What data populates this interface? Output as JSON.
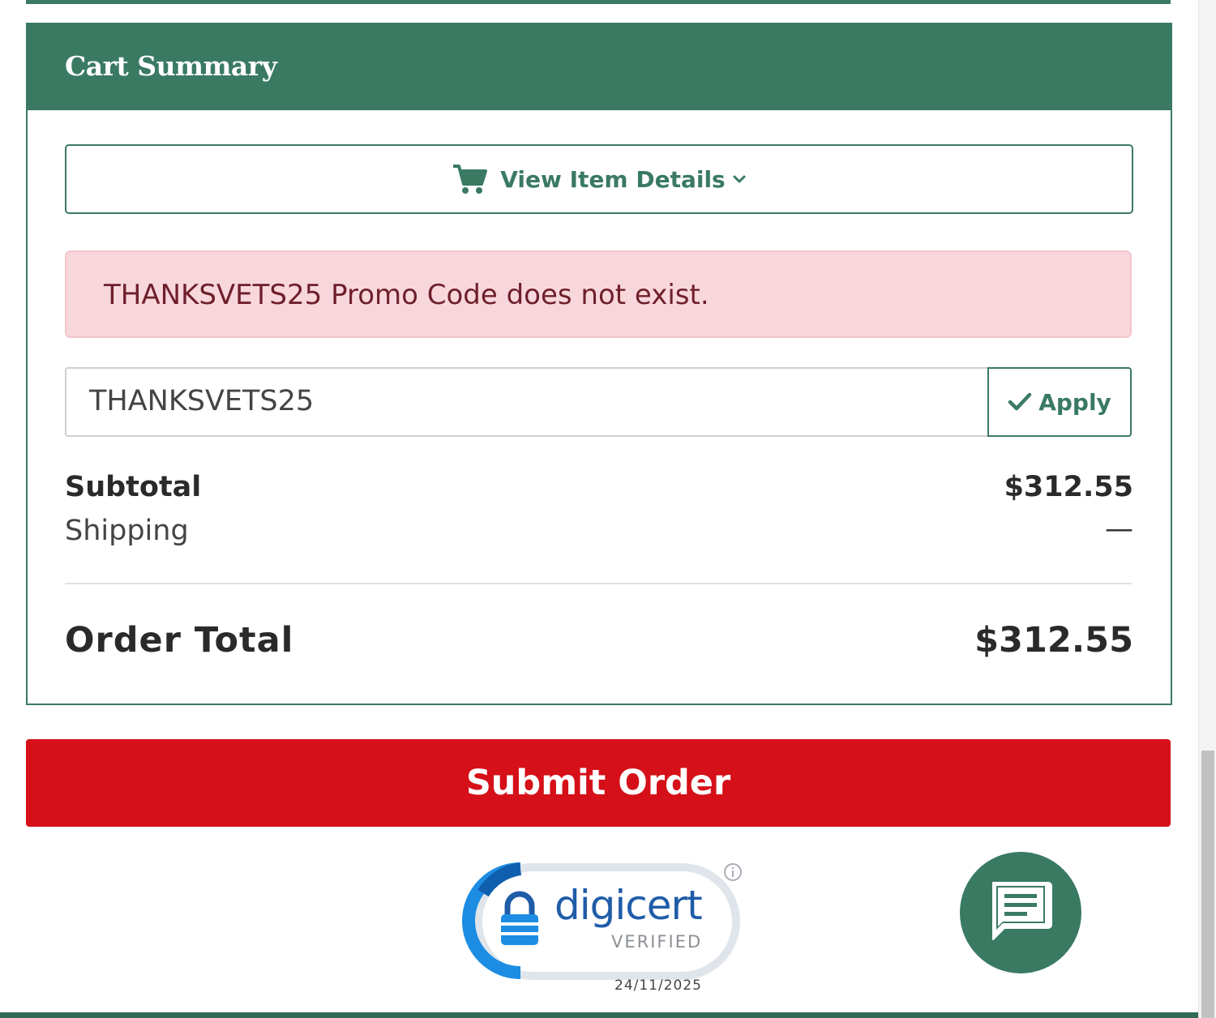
{
  "cart_summary": {
    "title": "Cart Summary",
    "view_details_label": "View Item Details",
    "view_details_icon": "shopping-cart-icon",
    "chevron_icon": "chevron-down-icon"
  },
  "alert": {
    "message": "THANKSVETS25 Promo Code does not exist."
  },
  "promo": {
    "value": "THANKSVETS25",
    "apply_label": "Apply",
    "apply_icon": "check-icon"
  },
  "totals": {
    "subtotal_label": "Subtotal",
    "subtotal_value": "$312.55",
    "shipping_label": "Shipping",
    "shipping_value": "—",
    "order_total_label": "Order Total",
    "order_total_value": "$312.55"
  },
  "submit": {
    "label": "Submit Order"
  },
  "seal": {
    "brand": "digicert",
    "verified": "VERIFIED",
    "date": "24/11/2025"
  },
  "chat": {
    "icon": "chat-icon"
  },
  "colors": {
    "brand_green": "#3a7a63",
    "submit_red": "#d51018",
    "alert_bg": "#f8d7dc",
    "alert_text": "#6e1f2b"
  }
}
